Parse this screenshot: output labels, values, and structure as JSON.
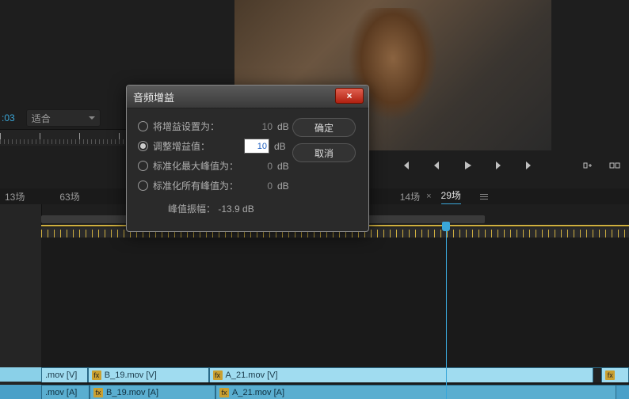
{
  "monitor": {},
  "time": {
    "code": ":03",
    "zoom": "适合"
  },
  "tabs": {
    "t1": "13场",
    "t2": "63场",
    "t3": "14场",
    "t4": "29场"
  },
  "clips": {
    "a1": ".mov [V]",
    "a2": "B_19.mov [V]",
    "a3": "A_21.mov [V]",
    "b1": ".mov [A]",
    "b2": "B_19.mov [A]",
    "b3": "A_21.mov [A]",
    "fx": "fx"
  },
  "dialog": {
    "title": "音频增益",
    "opts": {
      "o1": {
        "label": "将增益设置为：",
        "val": "10",
        "unit": "dB"
      },
      "o2": {
        "label": "调整增益值：",
        "val": "10",
        "unit": "dB"
      },
      "o3": {
        "label": "标准化最大峰值为：",
        "val": "0",
        "unit": "dB"
      },
      "o4": {
        "label": "标准化所有峰值为：",
        "val": "0",
        "unit": "dB"
      }
    },
    "peak_label": "峰值振幅：",
    "peak_val": "-13.9 dB",
    "ok": "确定",
    "cancel": "取消",
    "close": "×"
  },
  "transport": {}
}
